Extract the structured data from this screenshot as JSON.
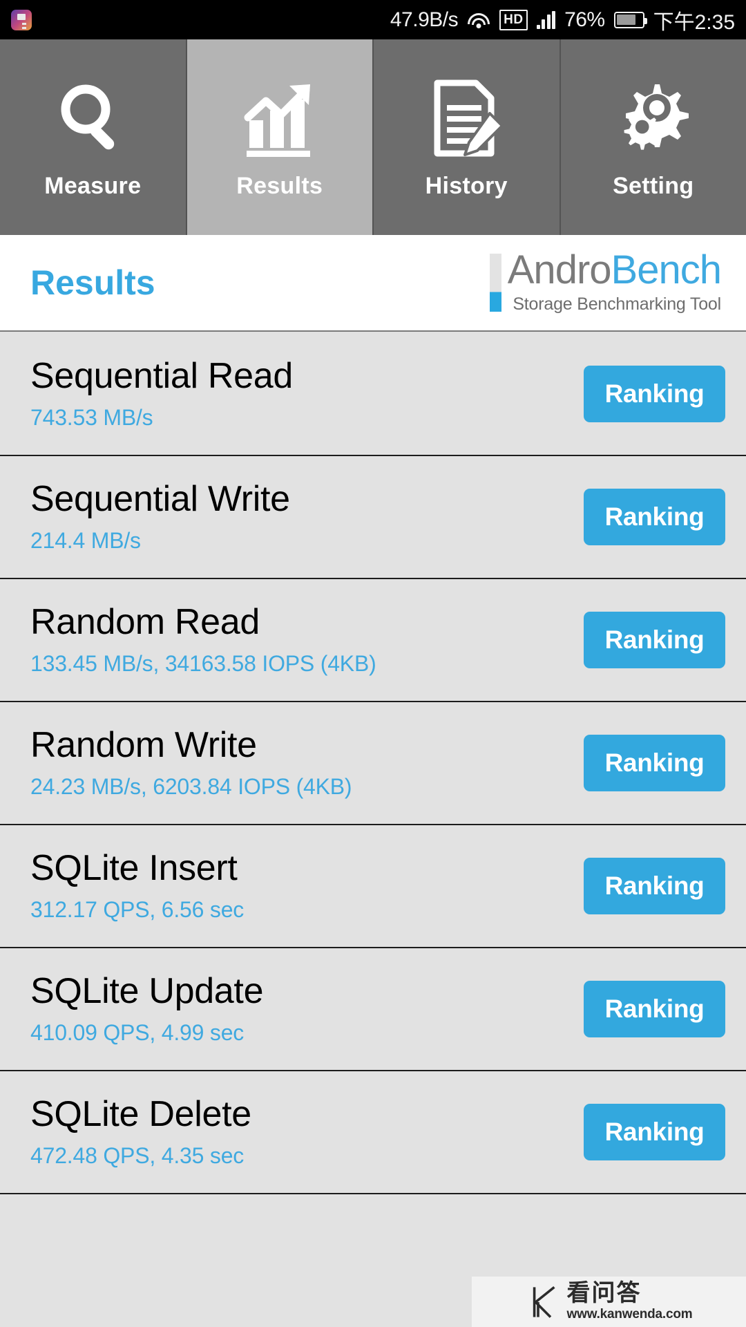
{
  "status_bar": {
    "app_icon": "app-icon",
    "network_speed": "47.9B/s",
    "wifi_icon": "wifi-icon",
    "hd_label": "HD",
    "signal_icon": "signal-bars-icon",
    "battery_percent": "76%",
    "battery_icon": "battery-icon",
    "time": "下午2:35"
  },
  "tabs": [
    {
      "label": "Measure",
      "icon": "magnifier-icon",
      "active": false
    },
    {
      "label": "Results",
      "icon": "bar-chart-arrow-icon",
      "active": true
    },
    {
      "label": "History",
      "icon": "document-pencil-icon",
      "active": false
    },
    {
      "label": "Setting",
      "icon": "gears-icon",
      "active": false
    }
  ],
  "header": {
    "title": "Results",
    "brand_andro": "Andro",
    "brand_bench": "Bench",
    "brand_subtitle": "Storage Benchmarking Tool"
  },
  "results": [
    {
      "title": "Sequential Read",
      "value": "743.53 MB/s",
      "button": "Ranking"
    },
    {
      "title": "Sequential Write",
      "value": "214.4 MB/s",
      "button": "Ranking"
    },
    {
      "title": "Random Read",
      "value": "133.45 MB/s, 34163.58 IOPS (4KB)",
      "button": "Ranking"
    },
    {
      "title": "Random Write",
      "value": "24.23 MB/s, 6203.84 IOPS (4KB)",
      "button": "Ranking"
    },
    {
      "title": "SQLite Insert",
      "value": "312.17 QPS, 6.56 sec",
      "button": "Ranking"
    },
    {
      "title": "SQLite Update",
      "value": "410.09 QPS, 4.99 sec",
      "button": "Ranking"
    },
    {
      "title": "SQLite Delete",
      "value": "472.48 QPS, 4.35 sec",
      "button": "Ranking"
    }
  ],
  "watermark": {
    "logo": "kanwenda-k-logo",
    "name": "看问答",
    "url": "www.kanwenda.com"
  },
  "colors": {
    "accent_blue": "#3fa9e0",
    "button_blue": "#33a8de",
    "tab_inactive": "#6d6d6d",
    "tab_active": "#b4b4b4",
    "row_bg": "#e2e2e2",
    "status_bar_bg": "#000000"
  }
}
